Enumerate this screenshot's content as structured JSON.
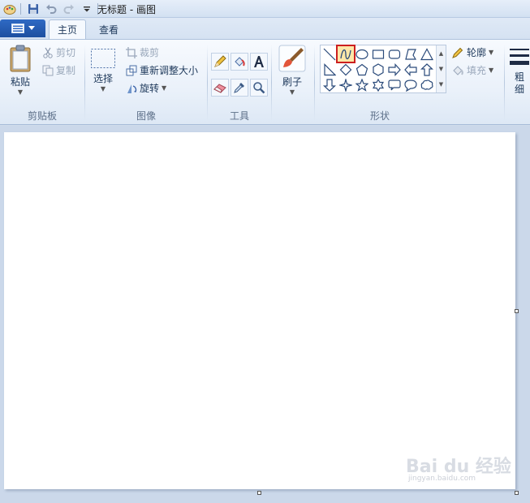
{
  "window": {
    "title": "无标题 - 画图"
  },
  "tabs": [
    {
      "label": "主页"
    },
    {
      "label": "查看"
    }
  ],
  "clipboard": {
    "paste": "粘贴",
    "cut": "剪切",
    "copy": "复制",
    "group": "剪贴板"
  },
  "image": {
    "select": "选择",
    "crop": "裁剪",
    "resize": "重新调整大小",
    "rotate": "旋转",
    "group": "图像"
  },
  "tools": {
    "group": "工具"
  },
  "brushes": {
    "label": "刷子"
  },
  "shapes": {
    "group": "形状",
    "outline": "轮廓",
    "fill": "填充"
  },
  "size": {
    "label": "粗细"
  },
  "watermark": {
    "brand": "Bai du 经验",
    "url": "jingyan.baidu.com"
  },
  "colors": {
    "accent": "#1d4fa0",
    "selected_outline": "#cc1f1f"
  }
}
